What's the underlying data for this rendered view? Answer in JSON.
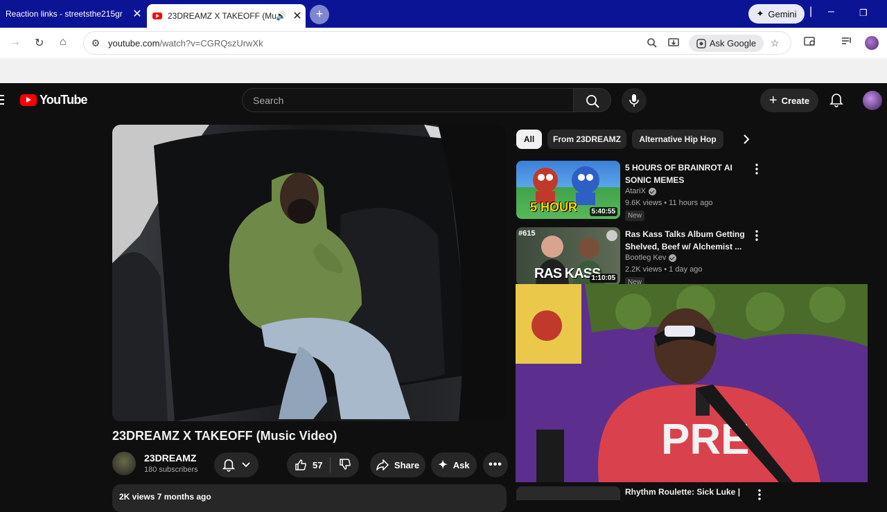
{
  "browser": {
    "tabs": [
      {
        "title": "Reaction links - streetsthe215gr"
      },
      {
        "title": "23DREAMZ X TAKEOFF (Mu"
      }
    ],
    "gemini_label": "Gemini",
    "url_host": "youtube.com",
    "url_path": "/watch?v=CGRQszUrwXk",
    "ask_google_label": "Ask Google"
  },
  "youtube": {
    "logo_text": "YouTube",
    "search_placeholder": "Search",
    "create_label": "Create"
  },
  "video": {
    "title": "23DREAMZ X TAKEOFF (Music Video)",
    "channel": "23DREAMZ",
    "subscribers": "180 subscribers",
    "likes": "57",
    "share_label": "Share",
    "ask_label": "Ask",
    "views_date": "2K views  7 months ago"
  },
  "sidebar": {
    "chips": [
      "All",
      "From 23DREAMZ",
      "Alternative Hip Hop"
    ],
    "recommendations": [
      {
        "title": "5 HOURS OF BRAINROT AI SONIC MEMES",
        "channel": "AtariX",
        "meta": "9.6K views • 11 hours ago",
        "badge": "New",
        "duration": "5:40:55",
        "thumb_text": "5 HOUR"
      },
      {
        "title": "Ras Kass Talks Album Getting Shelved, Beef w/ Alchemist ...",
        "channel": "Bootleg Kev",
        "meta": "2.2K views • 1 day ago",
        "badge": "New",
        "duration": "1:10:05",
        "thumb_text": "RAS KASS",
        "thumb_tag": "#615"
      },
      {
        "title": "Rhythm Roulette: Sick Luke |"
      }
    ]
  },
  "colors": {
    "browser_tabstrip": "#0c1496",
    "yt_background": "#0f0f0f",
    "yt_red": "#ff0000",
    "chip_bg": "#272727"
  }
}
